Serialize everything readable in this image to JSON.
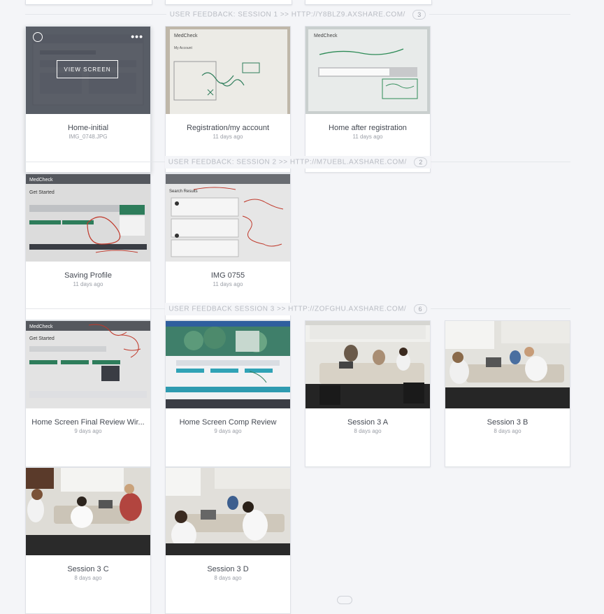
{
  "sections": [
    {
      "title": "USER FEEDBACK: SESSION 1 >> HTTP://Y8BLZ9.AXSHARE.COM/",
      "count": "3",
      "cards": [
        {
          "title": "Home-initial",
          "subtitle": "IMG_0748.JPG",
          "thumb": "ui-mock"
        },
        {
          "title": "Registration/my account",
          "subtitle": "11 days ago",
          "thumb": "paper-sketch"
        },
        {
          "title": "Home after registration",
          "subtitle": "11 days ago",
          "thumb": "paper-sketch-green"
        }
      ]
    },
    {
      "title": "USER FEEDBACK: SESSION 2 >> HTTP://M7UEBL.AXSHARE.COM/",
      "count": "2",
      "cards": [
        {
          "title": "Saving Profile",
          "subtitle": "11 days ago",
          "thumb": "printed-ui-red"
        },
        {
          "title": "IMG 0755",
          "subtitle": "11 days ago",
          "thumb": "printed-list-red"
        }
      ]
    },
    {
      "title": "USER FEEDBACK SESSION 3 >> HTTP://ZOFGHU.AXSHARE.COM/",
      "count": "6",
      "cards": [
        {
          "title": "Home Screen Final Review Wir...",
          "subtitle": "9 days ago",
          "thumb": "printed-ui-red"
        },
        {
          "title": "Home Screen Comp Review",
          "subtitle": "9 days ago",
          "thumb": "color-comp"
        },
        {
          "title": "Session 3 A",
          "subtitle": "8 days ago",
          "thumb": "photo-room"
        },
        {
          "title": "Session 3 B",
          "subtitle": "8 days ago",
          "thumb": "photo-room"
        },
        {
          "title": "Session 3 C",
          "subtitle": "8 days ago",
          "thumb": "photo-room"
        },
        {
          "title": "Session 3 D",
          "subtitle": "8 days ago",
          "thumb": "photo-room"
        }
      ]
    }
  ],
  "hover": {
    "view_label": "VIEW SCREEN",
    "select_icon": "circle-select-icon",
    "more_icon": "more-dots-icon",
    "more_glyph": "•••"
  },
  "thumbnail_labels": {
    "brand": "MedCheck",
    "my_account": "My Account",
    "get_started": "Get Started",
    "search_results": "Search Results"
  },
  "colors": {
    "background": "#f4f5f8",
    "overlay": "#303440",
    "muted_text": "#9a9ea6",
    "title_text": "#454a53"
  }
}
